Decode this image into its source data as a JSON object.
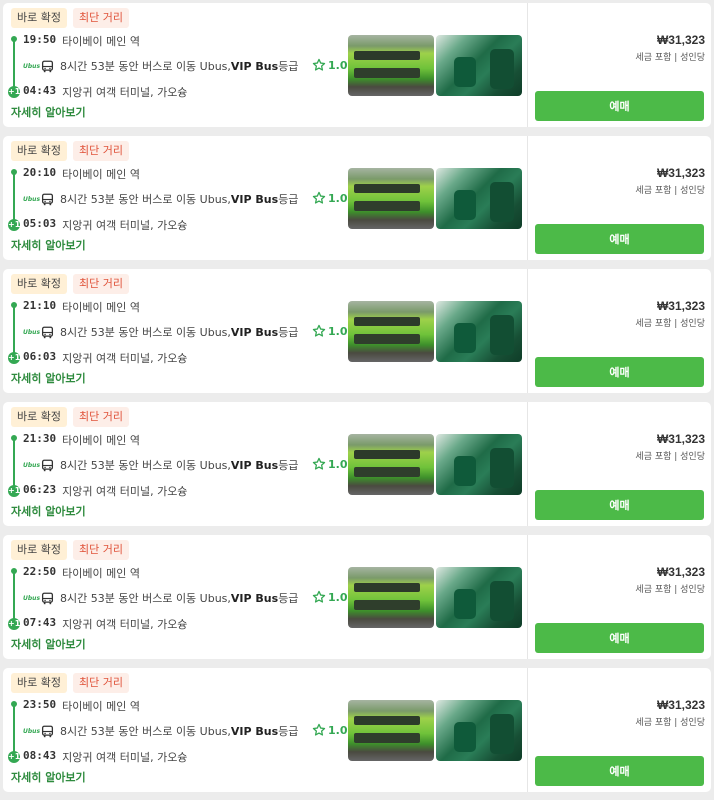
{
  "labels": {
    "badge_confirm": "바로 확정",
    "badge_shortest": "최단 거리",
    "more": "자세히 알아보기",
    "book": "예매",
    "price_note": "세금 포함 | 성인당",
    "operator_logo": "Ubus",
    "route_prefix": "8시간 53분 동안 버스로 이동 Ubus, ",
    "bus_class": "VIP Bus",
    "route_suffix": " 등급",
    "arrival_mark": "+1"
  },
  "colors": {
    "accent": "#4cba48",
    "timeline": "#34a853",
    "badge_confirm_bg": "#fff0d6",
    "badge_shortest_text": "#e0533a"
  },
  "icons": [
    "bus-icon",
    "star-icon"
  ],
  "trips": [
    {
      "dep_time": "19:50",
      "dep_station": "타이베이 메인 역",
      "arr_time": "04:43",
      "arr_station": "지앙귀 여객 터미널, 가오슝",
      "rating": "1.0",
      "price": "₩31,323"
    },
    {
      "dep_time": "20:10",
      "dep_station": "타이베이 메인 역",
      "arr_time": "05:03",
      "arr_station": "지앙귀 여객 터미널, 가오슝",
      "rating": "1.0",
      "price": "₩31,323"
    },
    {
      "dep_time": "21:10",
      "dep_station": "타이베이 메인 역",
      "arr_time": "06:03",
      "arr_station": "지앙귀 여객 터미널, 가오슝",
      "rating": "1.0",
      "price": "₩31,323"
    },
    {
      "dep_time": "21:30",
      "dep_station": "타이베이 메인 역",
      "arr_time": "06:23",
      "arr_station": "지앙귀 여객 터미널, 가오슝",
      "rating": "1.0",
      "price": "₩31,323"
    },
    {
      "dep_time": "22:50",
      "dep_station": "타이베이 메인 역",
      "arr_time": "07:43",
      "arr_station": "지앙귀 여객 터미널, 가오슝",
      "rating": "1.0",
      "price": "₩31,323"
    },
    {
      "dep_time": "23:50",
      "dep_station": "타이베이 메인 역",
      "arr_time": "08:43",
      "arr_station": "지앙귀 여객 터미널, 가오슝",
      "rating": "1.0",
      "price": "₩31,323"
    }
  ]
}
